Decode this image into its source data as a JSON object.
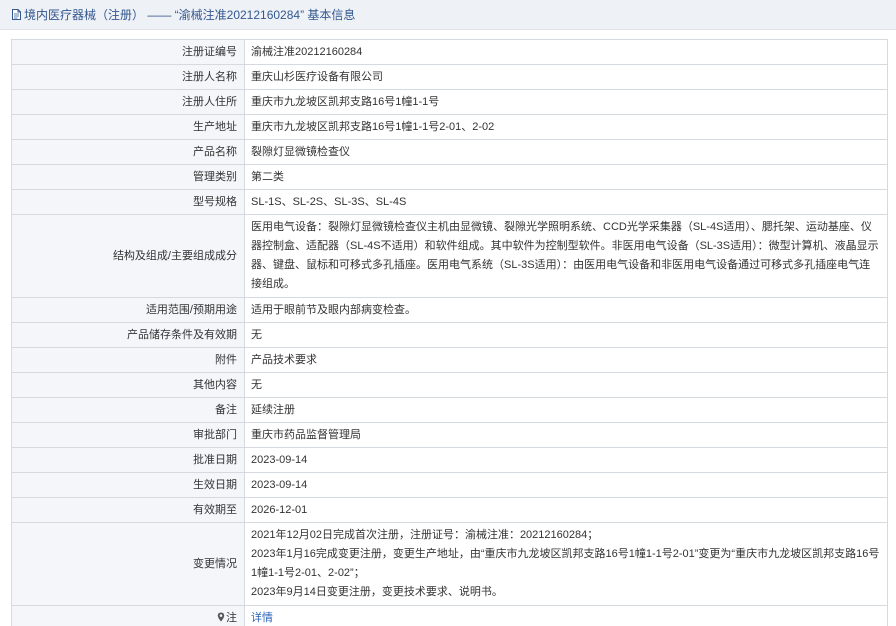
{
  "header": {
    "title": "境内医疗器械（注册） —— “渝械注准20212160284” 基本信息"
  },
  "rows": [
    {
      "label": "注册证编号",
      "value": "渝械注准20212160284"
    },
    {
      "label": "注册人名称",
      "value": "重庆山杉医疗设备有限公司"
    },
    {
      "label": "注册人住所",
      "value": "重庆市九龙坡区凯邦支路16号1幢1-1号"
    },
    {
      "label": "生产地址",
      "value": "重庆市九龙坡区凯邦支路16号1幢1-1号2-01、2-02"
    },
    {
      "label": "产品名称",
      "value": "裂隙灯显微镜检查仪"
    },
    {
      "label": "管理类别",
      "value": "第二类"
    },
    {
      "label": "型号规格",
      "value": "SL-1S、SL-2S、SL-3S、SL-4S"
    },
    {
      "label": "结构及组成/主要组成成分",
      "value": "医用电气设备：裂隙灯显微镜检查仪主机由显微镜、裂隙光学照明系统、CCD光学采集器（SL-4S适用）、腮托架、运动基座、仪器控制盒、适配器（SL-4S不适用）和软件组成。其中软件为控制型软件。非医用电气设备（SL-3S适用）：微型计算机、液晶显示器、键盘、鼠标和可移式多孔插座。医用电气系统（SL-3S适用）：由医用电气设备和非医用电气设备通过可移式多孔插座电气连接组成。"
    },
    {
      "label": "适用范围/预期用途",
      "value": "适用于眼前节及眼内部病变检查。"
    },
    {
      "label": "产品储存条件及有效期",
      "value": "无"
    },
    {
      "label": "附件",
      "value": "产品技术要求"
    },
    {
      "label": "其他内容",
      "value": "无"
    },
    {
      "label": "备注",
      "value": "延续注册"
    },
    {
      "label": "审批部门",
      "value": "重庆市药品监督管理局"
    },
    {
      "label": "批准日期",
      "value": "2023-09-14"
    },
    {
      "label": "生效日期",
      "value": "2023-09-14"
    },
    {
      "label": "有效期至",
      "value": "2026-12-01"
    }
  ],
  "change_history": {
    "label": "变更情况",
    "lines": [
      "2021年12月02日完成首次注册，注册证号：渝械注准：20212160284；",
      "2023年1月16完成变更注册，变更生产地址，由“重庆市九龙坡区凯邦支路16号1幢1-1号2-01”变更为“重庆市九龙坡区凯邦支路16号1幢1-1号2-01、2-02”；",
      "2023年9月14日变更注册，变更技术要求、说明书。"
    ]
  },
  "note": {
    "label": "注",
    "icon": "pin-icon",
    "link_text": "详情"
  },
  "colors": {
    "title_text": "#33578f",
    "header_bg": "#eef1f6",
    "label_bg": "#f4f6f9",
    "border": "#d5d9e0",
    "link": "#2b63b7"
  }
}
